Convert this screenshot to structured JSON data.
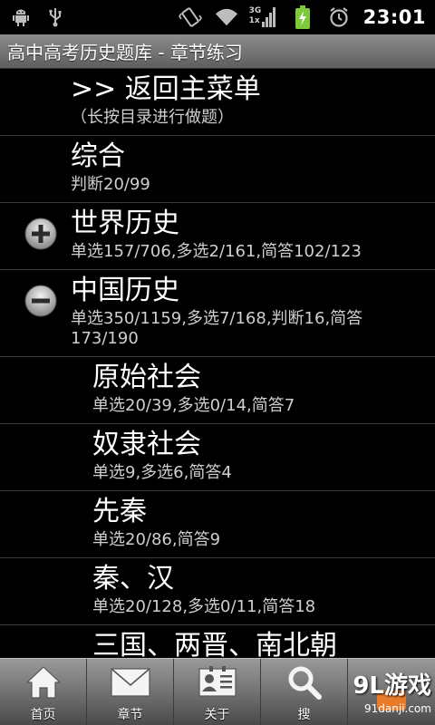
{
  "status_bar": {
    "time": "23:01",
    "net_label_top": "3G",
    "net_label_bottom": "1x",
    "icons_left": [
      "android-debug-icon",
      "usb-icon"
    ],
    "icons_right": [
      "vibrate-icon",
      "wifi-icon",
      "signal-icon",
      "battery-charging-icon",
      "alarm-icon"
    ]
  },
  "title_bar": {
    "title": "高中高考历史题库 - 章节练习"
  },
  "list": {
    "items": [
      {
        "title": ">> 返回主菜单",
        "sub": "（长按目录进行做题）"
      },
      {
        "title": "综合",
        "sub": "判断20/99"
      },
      {
        "title": "世界历史",
        "sub": "单选157/706,多选2/161,简答102/123",
        "expander": "plus"
      },
      {
        "title": "中国历史",
        "sub": "单选350/1159,多选7/168,判断16,简答173/190",
        "expander": "minus"
      },
      {
        "title": "原始社会",
        "sub": "单选20/39,多选0/14,简答7"
      },
      {
        "title": "奴隶社会",
        "sub": "单选9,多选6,简答4"
      },
      {
        "title": "先秦",
        "sub": "单选20/86,简答9"
      },
      {
        "title": "秦、汉",
        "sub": "单选20/128,多选0/11,简答18"
      },
      {
        "title": "三国、两晋、南北朝",
        "sub": ""
      }
    ]
  },
  "tab_bar": {
    "tabs": [
      {
        "label": "首页",
        "icon": "home-icon"
      },
      {
        "label": "章节",
        "icon": "mail-icon"
      },
      {
        "label": "关于",
        "icon": "contact-card-icon"
      },
      {
        "label": "搜",
        "icon": "search-icon"
      },
      {
        "label": "",
        "icon": "more-icon"
      }
    ]
  },
  "watermark": {
    "main": "9L游戏",
    "sub": "91danji.com"
  },
  "colors": {
    "background": "#000000",
    "title_bar": "#7a7a7a",
    "divider": "#3a3a3a",
    "battery": "#7ec93a"
  }
}
